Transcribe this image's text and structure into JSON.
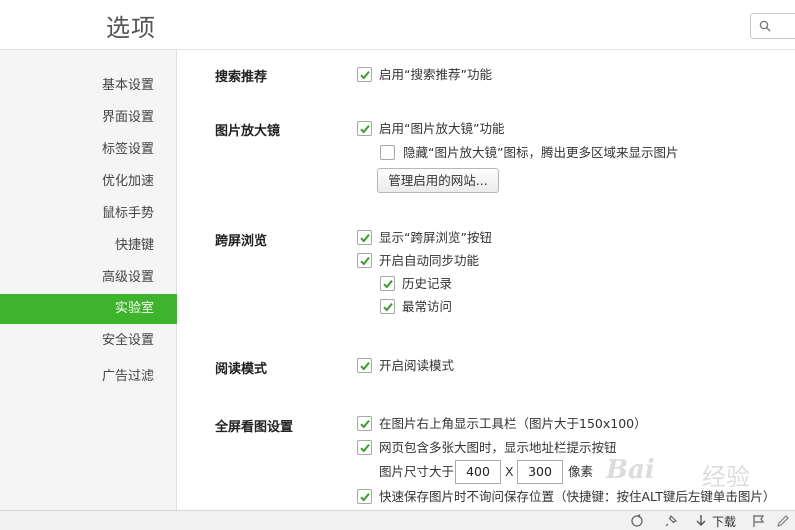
{
  "header": {
    "title": "选项",
    "search_icon": "search-icon"
  },
  "sidebar": {
    "items": [
      {
        "label": "基本设置",
        "active": false
      },
      {
        "label": "界面设置",
        "active": false
      },
      {
        "label": "标签设置",
        "active": false
      },
      {
        "label": "优化加速",
        "active": false
      },
      {
        "label": "鼠标手势",
        "active": false
      },
      {
        "label": "快捷键",
        "active": false
      },
      {
        "label": "高级设置",
        "active": false
      },
      {
        "label": "实验室",
        "active": true
      },
      {
        "label": "安全设置",
        "active": false
      },
      {
        "label": "广告过滤",
        "active": false
      }
    ],
    "active_color": "#3db42b"
  },
  "sections": {
    "search_recommend": {
      "title": "搜索推荐",
      "enable": {
        "label": "启用“搜索推荐”功能",
        "checked": true
      }
    },
    "magnifier": {
      "title": "图片放大镜",
      "enable": {
        "label": "启用“图片放大镜”功能",
        "checked": true
      },
      "hide_icon": {
        "label": "隐藏“图片放大镜”图标，腾出更多区域来显示图片",
        "checked": false
      },
      "manage_button": "管理启用的网站..."
    },
    "cross_screen": {
      "title": "跨屏浏览",
      "show_button": {
        "label": "显示“跨屏浏览”按钮",
        "checked": true
      },
      "auto_sync": {
        "label": "开启自动同步功能",
        "checked": true
      },
      "history": {
        "label": "历史记录",
        "checked": true
      },
      "frequent": {
        "label": "最常访问",
        "checked": true
      }
    },
    "reading_mode": {
      "title": "阅读模式",
      "enable": {
        "label": "开启阅读模式",
        "checked": true
      }
    },
    "fullscreen_image": {
      "title": "全屏看图设置",
      "toolbar": {
        "label": "在图片右上角显示工具栏（图片大于150x100）",
        "checked": true
      },
      "multi_image": {
        "label": "网页包含多张大图时，显示地址栏提示按钮",
        "checked": true
      },
      "size_label": "图片尺寸大于",
      "width": "400",
      "times": "X",
      "height": "300",
      "unit": "像素",
      "quick_save": {
        "label": "快速保存图片时不询问保存位置（快捷键：按住ALT键后左键单击图片）",
        "checked": true
      }
    }
  },
  "statusbar": {
    "download_label": "下载",
    "icons": [
      "refresh-icon",
      "pin-icon",
      "download-icon",
      "flag-icon",
      "edit-icon"
    ]
  },
  "watermark": {
    "text1": "Bai",
    "text2": "经验"
  },
  "colors": {
    "check": "#3a9d2c",
    "accent": "#3db42b"
  }
}
